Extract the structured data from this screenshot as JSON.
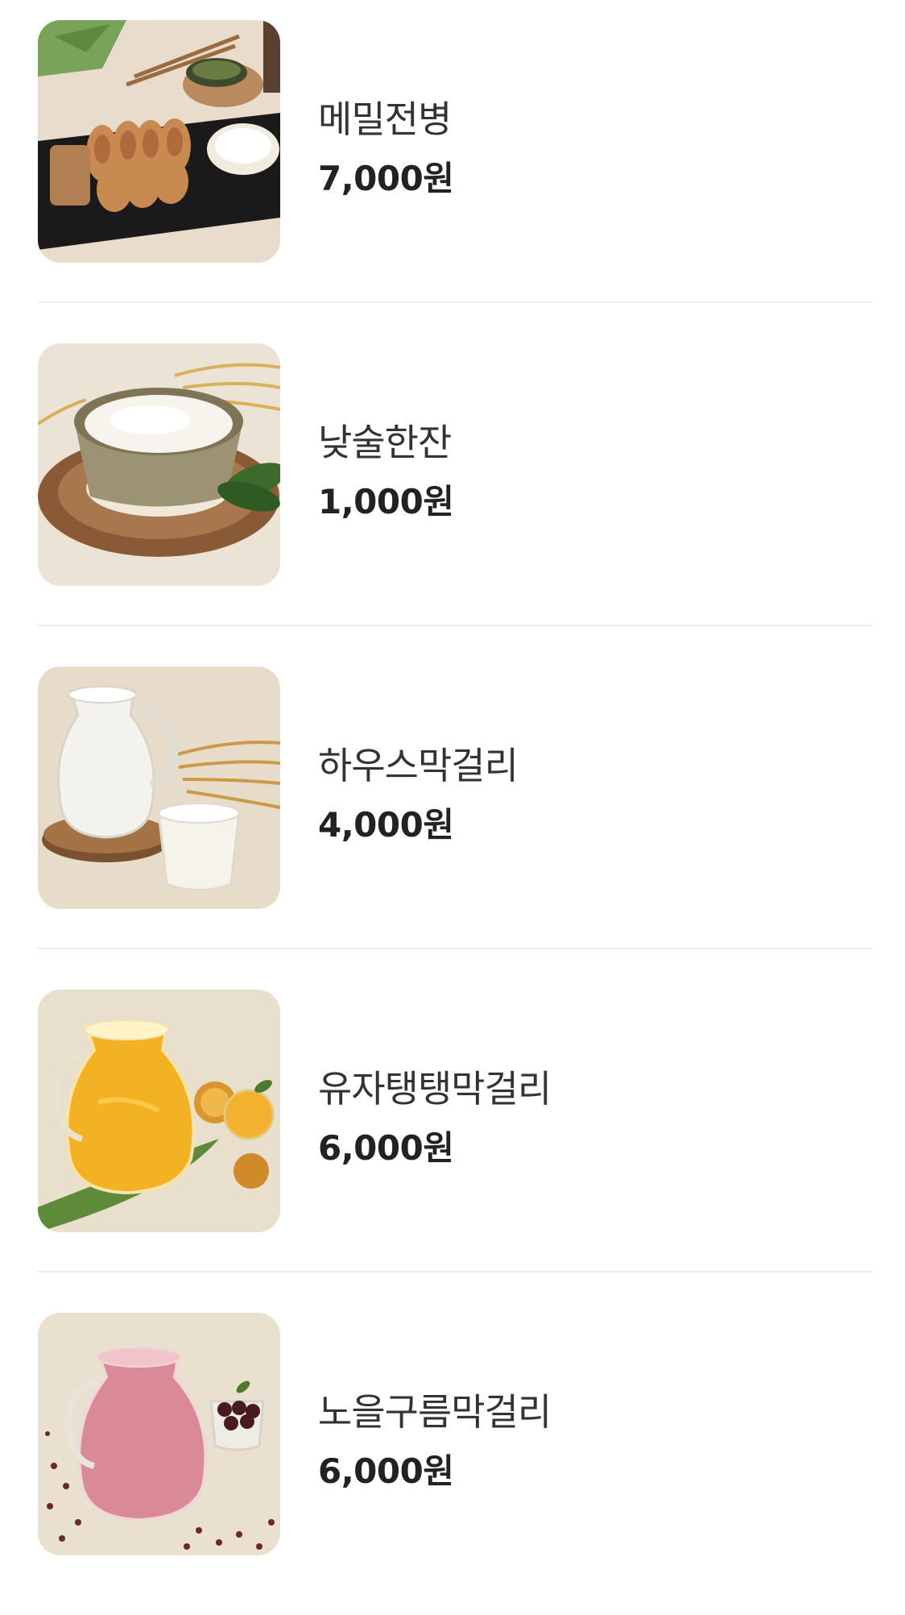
{
  "menu": {
    "items": [
      {
        "name": "메밀전병",
        "price": "7,000원",
        "image_icon": "buckwheat-crepe-photo"
      },
      {
        "name": "낮술한잔",
        "price": "1,000원",
        "image_icon": "makgeolli-bowl-photo"
      },
      {
        "name": "하우스막걸리",
        "price": "4,000원",
        "image_icon": "house-makgeolli-jug-photo"
      },
      {
        "name": "유자탱탱막걸리",
        "price": "6,000원",
        "image_icon": "yuja-makgeolli-jug-photo"
      },
      {
        "name": "노을구름막걸리",
        "price": "6,000원",
        "image_icon": "sunset-cloud-makgeolli-jug-photo"
      }
    ]
  },
  "colors": {
    "background": "#ffffff",
    "divider": "#eeeeee",
    "name_text": "#333333",
    "price_text": "#222222"
  }
}
